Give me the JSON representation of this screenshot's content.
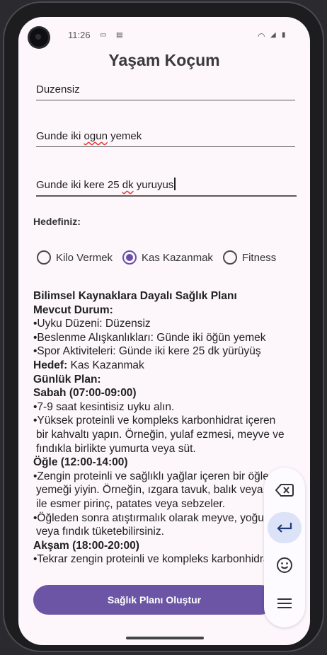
{
  "status": {
    "time": "11:26"
  },
  "app": {
    "title": "Yaşam Koçum"
  },
  "inputs": {
    "sleep": "Duzensiz",
    "diet_pre": "Gunde iki ",
    "diet_err": "ogun",
    "diet_post": " yemek",
    "sport_pre": "Gunde iki kere 25 ",
    "sport_err": "dk",
    "sport_post": " yuruyus"
  },
  "goal": {
    "label": "Hedefiniz:",
    "options": [
      "Kilo Vermek",
      "Kas Kazanmak",
      "Fitness"
    ],
    "selected": "Kas Kazanmak"
  },
  "plan": {
    "heading": "Bilimsel Kaynaklara Dayalı Sağlık Planı",
    "current_heading": "Mevcut Durum:",
    "current_items": [
      "•Uyku Düzeni: Düzensiz",
      "•Beslenme Alışkanlıkları: Günde iki öğün yemek",
      "•Spor Aktiviteleri: Günde iki kere 25 dk yürüyüş"
    ],
    "goal_label": "Hedef:",
    "goal_value": " Kas Kazanmak",
    "daily_heading": "Günlük Plan:",
    "morning_heading": "Sabah (07:00-09:00)",
    "morning_items": [
      "•7-9 saat kesintisiz uyku alın.",
      "•Yüksek proteinli ve kompleks karbonhidrat içeren",
      "bir kahvaltı yapın. Örneğin, yulaf ezmesi, meyve ve",
      "fındıkla birlikte yumurta veya süt."
    ],
    "noon_heading": "Öğle (12:00-14:00)",
    "noon_items": [
      "•Zengin proteinli ve sağlıklı yağlar içeren bir öğle",
      "yemeği yiyin. Örneğin, ızgara tavuk, balık veya tofu",
      "ile esmer pirinç, patates veya sebzeler.",
      "•Öğleden sonra atıştırmalık olarak meyve, yoğurt",
      "veya fındık tüketebilirsiniz."
    ],
    "evening_heading": "Akşam (18:00-20:00)",
    "evening_items": [
      "•Tekrar zengin proteinli ve kompleks karbonhidrat"
    ]
  },
  "button": {
    "create_plan": "Sağlık Planı Oluştur"
  },
  "keyboard": {
    "icons": [
      "backspace-icon",
      "enter-icon",
      "emoji-icon",
      "menu-icon"
    ]
  }
}
